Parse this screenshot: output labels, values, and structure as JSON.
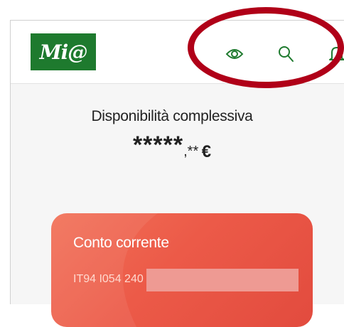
{
  "header": {
    "logo_text": "Mi@",
    "icons": [
      "eye-icon",
      "search-icon",
      "bell-icon"
    ]
  },
  "balance": {
    "label": "Disponibilità complessiva",
    "integer_part": "*****",
    "decimal_part": ",**",
    "currency": "€"
  },
  "account_card": {
    "title": "Conto corrente",
    "iban_partial": "IT94 I054 240"
  },
  "colors": {
    "brand_green": "#1e7a2e",
    "card_red": "#ec5a48",
    "highlight_ring": "#b00018",
    "icon_green": "#1e7a2e"
  }
}
